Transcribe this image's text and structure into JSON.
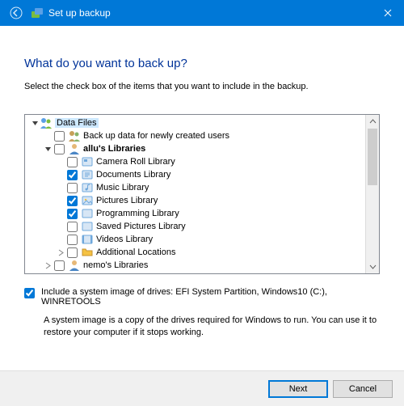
{
  "window": {
    "title": "Set up backup"
  },
  "heading": "What do you want to back up?",
  "instruction": "Select the check box of the items that you want to include in the backup.",
  "tree": {
    "root_label": "Data Files",
    "backup_new_users": "Back up data for newly created users",
    "user_libs_label": "allu's Libraries",
    "libs": {
      "camera_roll": "Camera Roll Library",
      "documents": "Documents Library",
      "music": "Music Library",
      "pictures": "Pictures Library",
      "programming": "Programming Library",
      "saved_pictures": "Saved Pictures Library",
      "videos": "Videos Library"
    },
    "additional": "Additional Locations",
    "nemo_libs": "nemo's Libraries"
  },
  "system_image": {
    "label": "Include a system image of drives: EFI System Partition, Windows10 (C:), WINRETOOLS",
    "desc": "A system image is a copy of the drives required for Windows to run. You can use it to restore your computer if it stops working."
  },
  "buttons": {
    "next": "Next",
    "cancel": "Cancel"
  }
}
